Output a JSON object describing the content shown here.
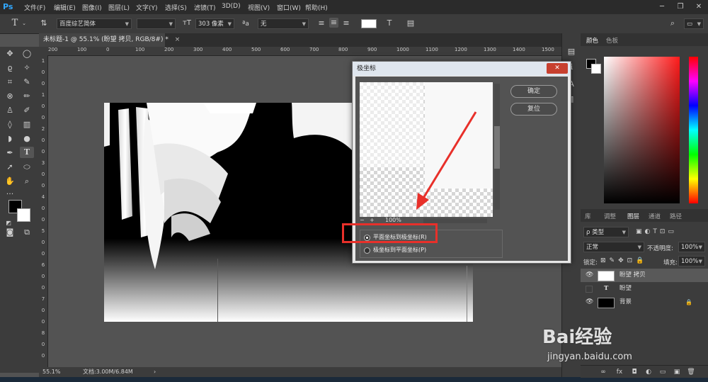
{
  "app": {
    "logo": "Ps"
  },
  "menu": [
    "文件(F)",
    "编辑(E)",
    "图像(I)",
    "图层(L)",
    "文字(Y)",
    "选择(S)",
    "滤镜(T)",
    "3D(D)",
    "视图(V)",
    "窗口(W)",
    "帮助(H)"
  ],
  "window_controls": {
    "minimize": "─",
    "restore": "❐",
    "close": "✕"
  },
  "options": {
    "tool_glyph": "T",
    "font_family": "百度综艺简体",
    "font_style": "",
    "font_size": "303 像素",
    "aa_label": "ªa",
    "antialias": "无"
  },
  "document": {
    "tab_title": "未标题-1 @ 55.1% (盼望 拷贝, RGB/8#) *",
    "tab_close": "×",
    "zoom": "55.1%",
    "doc_info": "文档:3.00M/6.84M",
    "status_arrow": "›"
  },
  "ruler_h": [
    "200",
    "100",
    "0",
    "100",
    "200",
    "300",
    "400",
    "500",
    "600",
    "700",
    "800",
    "900",
    "1000",
    "1100",
    "1200",
    "1300",
    "1400",
    "1500"
  ],
  "ruler_v": [
    "1",
    "0",
    "0",
    "1",
    "0",
    "0",
    "2",
    "0",
    "0",
    "3",
    "0",
    "0",
    "4",
    "0",
    "0",
    "5",
    "0",
    "0",
    "6",
    "0",
    "0",
    "7",
    "0",
    "0",
    "8",
    "0",
    "0"
  ],
  "right_panel": {
    "color_tabs": [
      "颜色",
      "色板"
    ],
    "layer_tabs": [
      "库",
      "调整",
      "图层",
      "通道",
      "路径"
    ],
    "filter_kind": "ρ 类型",
    "blend_mode": "正常",
    "opacity_label": "不透明度:",
    "opacity": "100%",
    "lock_label": "锁定:",
    "fill_label": "填充:",
    "fill": "100%",
    "layers": [
      {
        "name": "盼望 拷贝",
        "visible": true,
        "type": "raster",
        "selected": true
      },
      {
        "name": "盼望",
        "visible": false,
        "type": "text",
        "selected": false
      },
      {
        "name": "背景",
        "visible": true,
        "type": "background",
        "selected": false
      }
    ],
    "footer_icons": [
      "∞",
      "fx",
      "◘",
      "◐",
      "▭",
      "▣",
      "🗑"
    ]
  },
  "dialog": {
    "title": "极坐标",
    "ok": "确定",
    "reset": "复位",
    "zoom": "100%",
    "zoom_minus": "−",
    "zoom_plus": "+",
    "option_rect_to_polar": "平面坐标到极坐标(R)",
    "option_polar_to_rect": "极坐标到平面坐标(P)",
    "selected_option": "rect_to_polar",
    "close": "✕"
  },
  "watermark": {
    "brand": "Bai经验",
    "url": "jingyan.baidu.com"
  },
  "colors": {
    "highlight": "#e8302a",
    "accent": "#31a8ff"
  }
}
